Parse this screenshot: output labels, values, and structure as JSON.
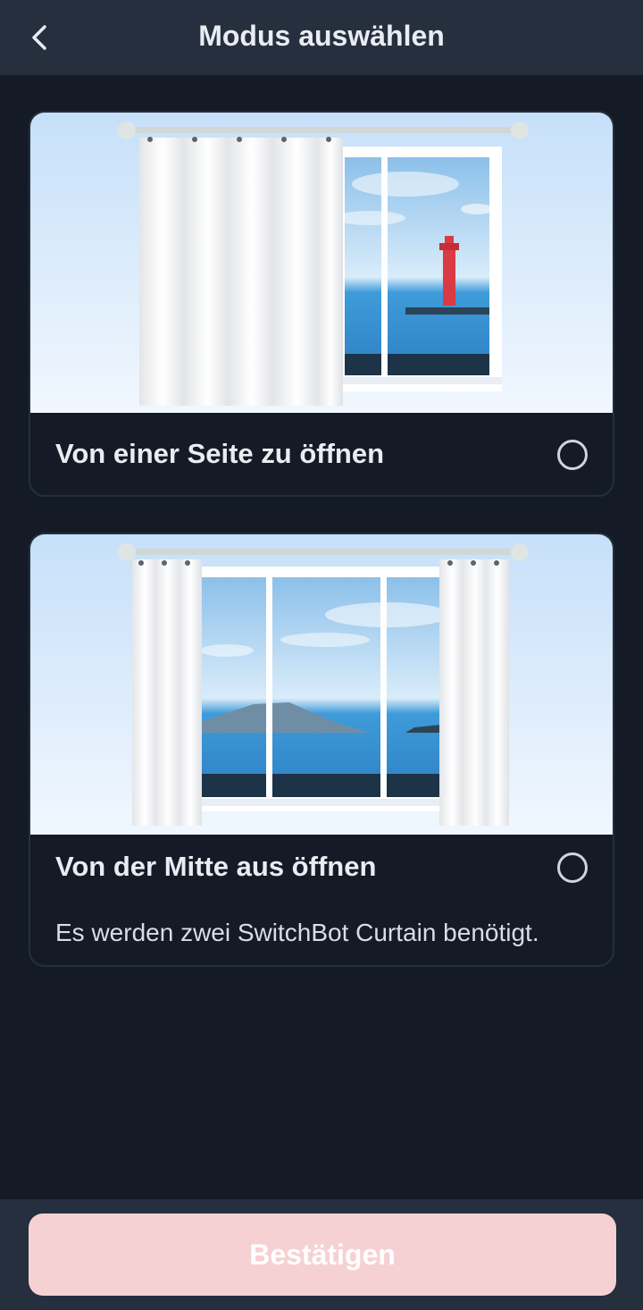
{
  "header": {
    "title": "Modus auswählen"
  },
  "options": [
    {
      "label": "Von einer Seite zu öffnen",
      "selected": false
    },
    {
      "label": "Von der Mitte aus öffnen",
      "note": "Es werden zwei SwitchBot Curtain benötigt.",
      "selected": false
    }
  ],
  "footer": {
    "confirm_label": "Bestätigen"
  },
  "colors": {
    "background": "#141b26",
    "header": "#252f3e",
    "confirm_disabled": "#f6d1d3"
  }
}
